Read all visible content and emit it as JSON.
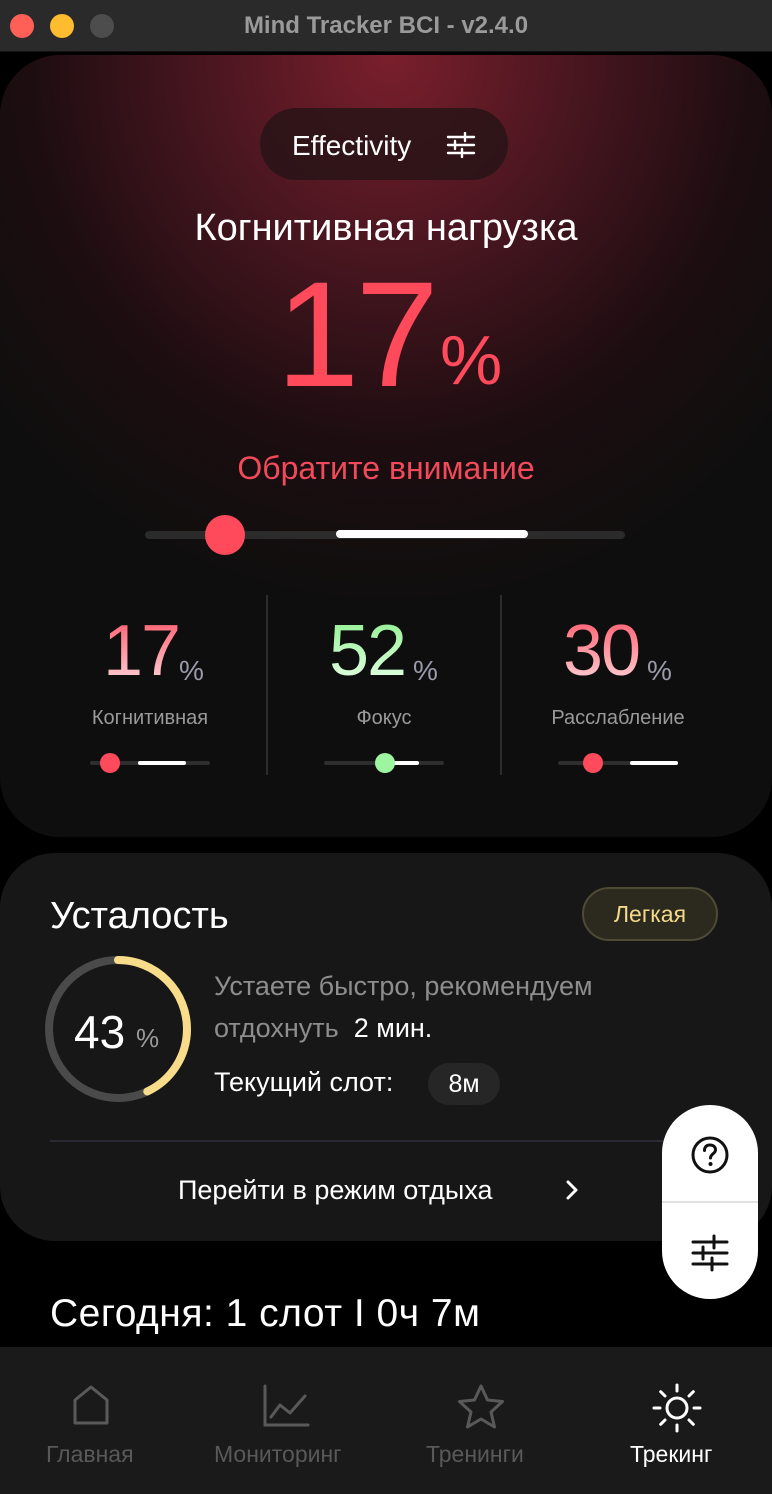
{
  "window": {
    "title": "Mind Tracker BCI - v2.4.0"
  },
  "hero": {
    "mode_label": "Effectivity",
    "mode_icon": "sliders-icon",
    "title": "Когнитивная нагрузка",
    "value": "17",
    "unit": "%",
    "status": "Обратите внимание",
    "accent_color": "#ff4a5c"
  },
  "metrics": [
    {
      "value": "17",
      "unit": "%",
      "name": "Когнитивная",
      "color": "#ff4a5c"
    },
    {
      "value": "52",
      "unit": "%",
      "name": "Фокус",
      "color": "#9df59f"
    },
    {
      "value": "30",
      "unit": "%",
      "name": "Расслабление",
      "color": "#ff4a5c"
    }
  ],
  "fatigue": {
    "title": "Усталость",
    "badge": "Легкая",
    "percent": 43,
    "percent_label": "43",
    "unit": "%",
    "advice": "Устаете быстро, рекомендуем",
    "advice_rest": "отдохнуть",
    "advice_time": "2 мин.",
    "slot_label": "Текущий слот:",
    "slot_value": "8м",
    "rest_link": "Перейти в режим отдыха",
    "ring_color": "#f8dc8a"
  },
  "floating": {
    "help_icon": "help-circle-icon",
    "settings_icon": "sliders-icon"
  },
  "today": "Сегодня:  1 слот  I  0ч 7м",
  "nav": [
    {
      "label": "Главная",
      "icon": "home-icon"
    },
    {
      "label": "Мониторинг",
      "icon": "chart-line-icon"
    },
    {
      "label": "Тренинги",
      "icon": "star-icon"
    },
    {
      "label": "Трекинг",
      "icon": "sun-icon",
      "active": true
    }
  ]
}
